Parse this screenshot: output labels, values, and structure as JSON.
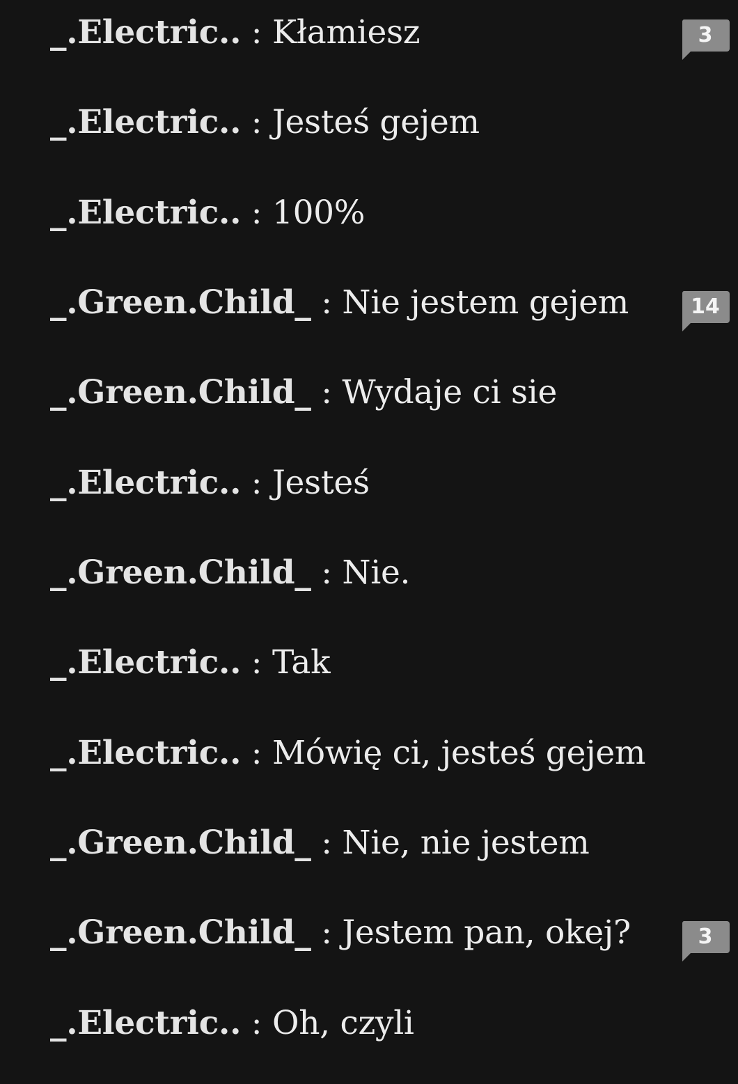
{
  "messages": [
    {
      "speaker": "_.Electric..",
      "separator": " : ",
      "text": "Kłamiesz",
      "badge": "3"
    },
    {
      "speaker": "_.Electric..",
      "separator": " : ",
      "text": "Jesteś gejem"
    },
    {
      "speaker": "_.Electric..",
      "separator": " : ",
      "text": "100%"
    },
    {
      "speaker": "_.Green.Child_",
      "separator": " : ",
      "text": "Nie jestem gejem",
      "badge": "14"
    },
    {
      "speaker": "_.Green.Child_",
      "separator": " : ",
      "text": "Wydaje ci sie"
    },
    {
      "speaker": "_.Electric..",
      "separator": " :  ",
      "text": "Jesteś"
    },
    {
      "speaker": "_.Green.Child_",
      "separator": " : ",
      "text": "Nie."
    },
    {
      "speaker": "_.Electric..",
      "separator": " : ",
      "text": "Tak"
    },
    {
      "speaker": "_.Electric..",
      "separator": " : ",
      "text": "Mówię ci, jesteś gejem"
    },
    {
      "speaker": "_.Green.Child_",
      "separator": " : ",
      "text": "Nie, nie jestem"
    },
    {
      "speaker": "_.Green.Child_",
      "separator": " : ",
      "text": "Jestem pan, okej?",
      "badge": "3"
    },
    {
      "speaker": "_.Electric..",
      "separator": " : ",
      "text": "Oh, czyli"
    }
  ],
  "badge_icon": "comment-bubble-icon",
  "colors": {
    "background": "#141414",
    "text": "#e9e9e9",
    "badge": "#8b8b8b"
  }
}
